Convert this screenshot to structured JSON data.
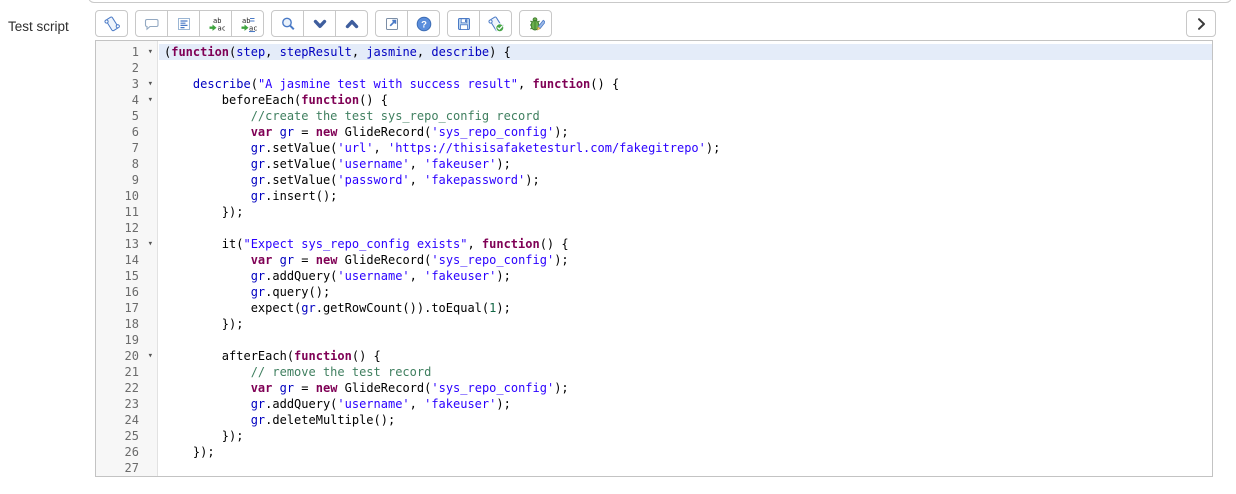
{
  "field_label": "Test script",
  "toolbar": {
    "groups": [
      {
        "buttons": [
          {
            "name": "toggle-syntax-editor",
            "icon": "scroll-icon"
          }
        ]
      },
      {
        "buttons": [
          {
            "name": "toggle-comment",
            "icon": "comment-icon"
          },
          {
            "name": "format-code",
            "icon": "format-icon"
          },
          {
            "name": "replace",
            "icon": "replace-icon"
          },
          {
            "name": "replace-all",
            "icon": "replace-all-icon"
          }
        ]
      },
      {
        "buttons": [
          {
            "name": "search",
            "icon": "search-icon"
          },
          {
            "name": "find-next",
            "icon": "chevron-down-icon"
          },
          {
            "name": "find-previous",
            "icon": "chevron-up-icon"
          }
        ]
      },
      {
        "buttons": [
          {
            "name": "open-fullscreen",
            "icon": "popout-icon"
          },
          {
            "name": "help",
            "icon": "help-icon"
          }
        ]
      },
      {
        "buttons": [
          {
            "name": "save",
            "icon": "save-icon"
          },
          {
            "name": "syntax-check",
            "icon": "scroll-check-icon"
          }
        ]
      },
      {
        "buttons": [
          {
            "name": "debug-script",
            "icon": "bug-icon"
          }
        ]
      }
    ],
    "collapse_button": {
      "name": "collapse-panel",
      "icon": "chevron-right-icon"
    }
  },
  "editor": {
    "syntax_colors": {
      "keyword": "#7F0055",
      "string": "#2A00FF",
      "comment": "#3F7F5F",
      "variable": "#0000C0",
      "number": "#116644",
      "plain": "#000000",
      "active_line_bg": "#e4ecf9",
      "gutter_bg": "#f7f7f7",
      "line_number": "#6b6b6b"
    },
    "active_line": 1,
    "fold_lines": [
      1,
      3,
      4,
      13,
      20
    ],
    "fold_marker": "▾",
    "lines": [
      {
        "num": 1,
        "tokens": [
          [
            "(",
            "p"
          ],
          [
            "function",
            "k"
          ],
          [
            "(",
            "p"
          ],
          [
            "step",
            "v"
          ],
          [
            ", ",
            "p"
          ],
          [
            "stepResult",
            "v"
          ],
          [
            ", ",
            "p"
          ],
          [
            "jasmine",
            "v"
          ],
          [
            ", ",
            "p"
          ],
          [
            "describe",
            "v"
          ],
          [
            ") {",
            "p"
          ]
        ]
      },
      {
        "num": 2,
        "tokens": []
      },
      {
        "num": 3,
        "tokens": [
          [
            "    ",
            "p"
          ],
          [
            "describe",
            "v"
          ],
          [
            "(",
            "p"
          ],
          [
            "\"A jasmine test with success result\"",
            "s"
          ],
          [
            ", ",
            "p"
          ],
          [
            "function",
            "k"
          ],
          [
            "() {",
            "p"
          ]
        ]
      },
      {
        "num": 4,
        "tokens": [
          [
            "        beforeEach(",
            "p"
          ],
          [
            "function",
            "k"
          ],
          [
            "() {",
            "p"
          ]
        ]
      },
      {
        "num": 5,
        "tokens": [
          [
            "            ",
            "p"
          ],
          [
            "//create the test sys_repo_config record",
            "c"
          ]
        ]
      },
      {
        "num": 6,
        "tokens": [
          [
            "            ",
            "p"
          ],
          [
            "var",
            "k"
          ],
          [
            " ",
            "p"
          ],
          [
            "gr",
            "v"
          ],
          [
            " = ",
            "p"
          ],
          [
            "new",
            "k"
          ],
          [
            " GlideRecord(",
            "p"
          ],
          [
            "'sys_repo_config'",
            "s"
          ],
          [
            ");",
            "p"
          ]
        ]
      },
      {
        "num": 7,
        "tokens": [
          [
            "            ",
            "p"
          ],
          [
            "gr",
            "v"
          ],
          [
            ".setValue(",
            "p"
          ],
          [
            "'url'",
            "s"
          ],
          [
            ", ",
            "p"
          ],
          [
            "'https://thisisafaketesturl.com/fakegitrepo'",
            "s"
          ],
          [
            ");",
            "p"
          ]
        ]
      },
      {
        "num": 8,
        "tokens": [
          [
            "            ",
            "p"
          ],
          [
            "gr",
            "v"
          ],
          [
            ".setValue(",
            "p"
          ],
          [
            "'username'",
            "s"
          ],
          [
            ", ",
            "p"
          ],
          [
            "'fakeuser'",
            "s"
          ],
          [
            ");",
            "p"
          ]
        ]
      },
      {
        "num": 9,
        "tokens": [
          [
            "            ",
            "p"
          ],
          [
            "gr",
            "v"
          ],
          [
            ".setValue(",
            "p"
          ],
          [
            "'password'",
            "s"
          ],
          [
            ", ",
            "p"
          ],
          [
            "'fakepassword'",
            "s"
          ],
          [
            ");",
            "p"
          ]
        ]
      },
      {
        "num": 10,
        "tokens": [
          [
            "            ",
            "p"
          ],
          [
            "gr",
            "v"
          ],
          [
            ".insert();",
            "p"
          ]
        ]
      },
      {
        "num": 11,
        "tokens": [
          [
            "        });",
            "p"
          ]
        ]
      },
      {
        "num": 12,
        "tokens": []
      },
      {
        "num": 13,
        "tokens": [
          [
            "        it(",
            "p"
          ],
          [
            "\"Expect sys_repo_config exists\"",
            "s"
          ],
          [
            ", ",
            "p"
          ],
          [
            "function",
            "k"
          ],
          [
            "() {",
            "p"
          ]
        ]
      },
      {
        "num": 14,
        "tokens": [
          [
            "            ",
            "p"
          ],
          [
            "var",
            "k"
          ],
          [
            " ",
            "p"
          ],
          [
            "gr",
            "v"
          ],
          [
            " = ",
            "p"
          ],
          [
            "new",
            "k"
          ],
          [
            " GlideRecord(",
            "p"
          ],
          [
            "'sys_repo_config'",
            "s"
          ],
          [
            ");",
            "p"
          ]
        ]
      },
      {
        "num": 15,
        "tokens": [
          [
            "            ",
            "p"
          ],
          [
            "gr",
            "v"
          ],
          [
            ".addQuery(",
            "p"
          ],
          [
            "'username'",
            "s"
          ],
          [
            ", ",
            "p"
          ],
          [
            "'fakeuser'",
            "s"
          ],
          [
            ");",
            "p"
          ]
        ]
      },
      {
        "num": 16,
        "tokens": [
          [
            "            ",
            "p"
          ],
          [
            "gr",
            "v"
          ],
          [
            ".query();",
            "p"
          ]
        ]
      },
      {
        "num": 17,
        "tokens": [
          [
            "            expect(",
            "p"
          ],
          [
            "gr",
            "v"
          ],
          [
            ".getRowCount()).toEqual(",
            "p"
          ],
          [
            "1",
            "n"
          ],
          [
            ");",
            "p"
          ]
        ]
      },
      {
        "num": 18,
        "tokens": [
          [
            "        });",
            "p"
          ]
        ]
      },
      {
        "num": 19,
        "tokens": []
      },
      {
        "num": 20,
        "tokens": [
          [
            "        afterEach(",
            "p"
          ],
          [
            "function",
            "k"
          ],
          [
            "() {",
            "p"
          ]
        ]
      },
      {
        "num": 21,
        "tokens": [
          [
            "            ",
            "p"
          ],
          [
            "// remove the test record",
            "c"
          ]
        ]
      },
      {
        "num": 22,
        "tokens": [
          [
            "            ",
            "p"
          ],
          [
            "var",
            "k"
          ],
          [
            " ",
            "p"
          ],
          [
            "gr",
            "v"
          ],
          [
            " = ",
            "p"
          ],
          [
            "new",
            "k"
          ],
          [
            " GlideRecord(",
            "p"
          ],
          [
            "'sys_repo_config'",
            "s"
          ],
          [
            ");",
            "p"
          ]
        ]
      },
      {
        "num": 23,
        "tokens": [
          [
            "            ",
            "p"
          ],
          [
            "gr",
            "v"
          ],
          [
            ".addQuery(",
            "p"
          ],
          [
            "'username'",
            "s"
          ],
          [
            ", ",
            "p"
          ],
          [
            "'fakeuser'",
            "s"
          ],
          [
            ");",
            "p"
          ]
        ]
      },
      {
        "num": 24,
        "tokens": [
          [
            "            ",
            "p"
          ],
          [
            "gr",
            "v"
          ],
          [
            ".deleteMultiple();",
            "p"
          ]
        ]
      },
      {
        "num": 25,
        "tokens": [
          [
            "        });",
            "p"
          ]
        ]
      },
      {
        "num": 26,
        "tokens": [
          [
            "    });",
            "p"
          ]
        ]
      },
      {
        "num": 27,
        "tokens": []
      }
    ]
  }
}
